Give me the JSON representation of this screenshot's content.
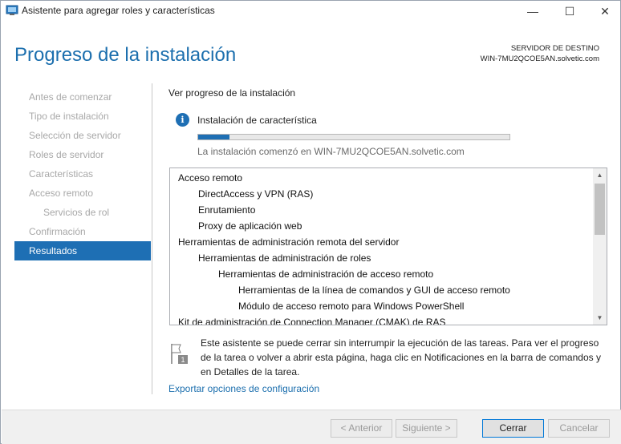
{
  "window": {
    "title": "Asistente para agregar roles y características",
    "minimize": "—",
    "maximize": "☐",
    "close": "✕"
  },
  "header": {
    "title": "Progreso de la instalación",
    "destination_label": "SERVIDOR DE DESTINO",
    "destination_server": "WIN-7MU2QCOE5AN.solvetic.com"
  },
  "sidebar": {
    "items": [
      {
        "label": "Antes de comenzar"
      },
      {
        "label": "Tipo de instalación"
      },
      {
        "label": "Selección de servidor"
      },
      {
        "label": "Roles de servidor"
      },
      {
        "label": "Características"
      },
      {
        "label": "Acceso remoto"
      },
      {
        "label": "Servicios de rol"
      },
      {
        "label": "Confirmación"
      },
      {
        "label": "Resultados"
      }
    ]
  },
  "main": {
    "section_title": "Ver progreso de la instalación",
    "status_icon": "info-icon",
    "status_text": "Instalación de característica",
    "progress": 0.1,
    "start_text": "La instalación comenzó en WIN-7MU2QCOE5AN.solvetic.com",
    "features": [
      {
        "label": "Acceso remoto"
      },
      {
        "label": "DirectAccess y VPN (RAS)"
      },
      {
        "label": "Enrutamiento"
      },
      {
        "label": "Proxy de aplicación web"
      },
      {
        "label": "Herramientas de administración remota del servidor"
      },
      {
        "label": "Herramientas de administración de roles"
      },
      {
        "label": "Herramientas de administración de acceso remoto"
      },
      {
        "label": "Herramientas de la línea de comandos y GUI de acceso remoto"
      },
      {
        "label": "Módulo de acceso remoto para Windows PowerShell"
      },
      {
        "label": "Kit de administración de Connection Manager (CMAK) de RAS"
      }
    ],
    "note": "Este asistente se puede cerrar sin interrumpir la ejecución de las tareas. Para ver el progreso de la tarea o volver a abrir esta página, haga clic en Notificaciones en la barra de comandos y en Detalles de la tarea.",
    "export_link": "Exportar opciones de configuración"
  },
  "footer": {
    "previous": "< Anterior",
    "next": "Siguiente >",
    "close": "Cerrar",
    "cancel": "Cancelar"
  },
  "colors": {
    "accent": "#1e6fb4",
    "title": "#1c6fae",
    "disabled_text": "#a8a8a8"
  }
}
